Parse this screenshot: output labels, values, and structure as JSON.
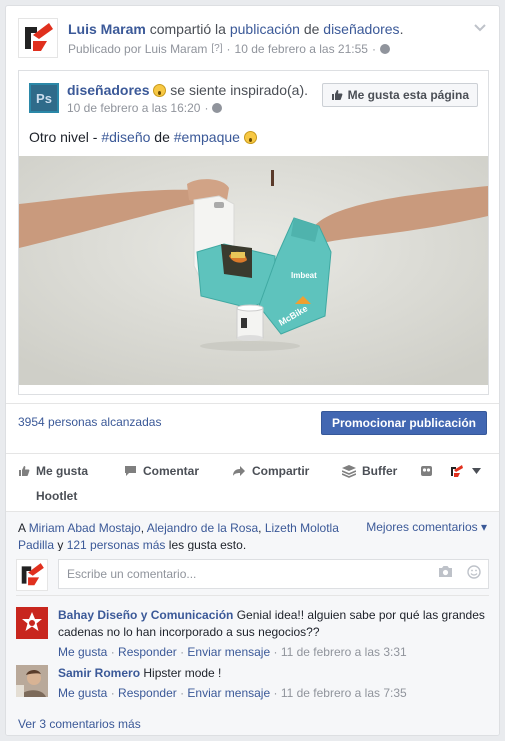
{
  "post": {
    "author": "Luis Maram",
    "shared_text": "compartió la",
    "publication_link": "publicación",
    "de_text": "de",
    "page_link": "diseñadores",
    "period": ".",
    "published_by": "Publicado por Luis Maram",
    "help_marker": "[?]",
    "dot": "·",
    "date": "10 de febrero a las 21:55",
    "dot2": "·"
  },
  "shared_post": {
    "page_name": "diseñadores",
    "feeling": "se siente inspirado(a).",
    "date": "10 de febrero a las 16:20",
    "dot": "·",
    "like_page_label": "Me gusta esta página",
    "body_prefix": "Otro nivel - ",
    "hashtag1": "#diseño",
    "body_mid": " de ",
    "hashtag2": "#empaque",
    "logo_letters": "Ps",
    "photo_brand": "McBike",
    "photo_brand2": "Imbeat"
  },
  "reach": {
    "text": "3954 personas alcanzadas",
    "promote_label": "Promocionar publicación"
  },
  "actions": {
    "like": "Me gusta",
    "comment": "Comentar",
    "share": "Compartir",
    "buffer": "Buffer",
    "hootlet": "Hootlet"
  },
  "likes": {
    "prefix": "A ",
    "name1": "Miriam Abad Mostajo",
    "sep1": ", ",
    "name2": "Alejandro de la Rosa",
    "sep2": ", ",
    "name3": "Lizeth Molotla Padilla",
    "mid": " y ",
    "others": "121 personas más",
    "suffix": " les gusta esto.",
    "best_comments": "Mejores comentarios ▾"
  },
  "comment_box": {
    "placeholder": "Escribe un comentario..."
  },
  "comments": [
    {
      "author": "Bahay Diseño y Comunicación",
      "text": " Genial idea!! alguien sabe por qué las grandes cadenas no lo han incorporado a sus negocios??",
      "like": "Me gusta",
      "reply": "Responder",
      "message": "Enviar mensaje",
      "sep": " · ",
      "date": "11 de febrero a las 3:31"
    },
    {
      "author": "Samir Romero",
      "text": " Hipster mode !",
      "like": "Me gusta",
      "reply": "Responder",
      "message": "Enviar mensaje",
      "sep": " · ",
      "date": "11 de febrero a las 7:35"
    }
  ],
  "more_comments": "Ver 3 comentarios más",
  "colors": {
    "link": "#3b5998",
    "promote": "#4267b2",
    "muted": "#90949c",
    "teal_box": "#5ec3bd",
    "brand_red": "#e0301e"
  }
}
